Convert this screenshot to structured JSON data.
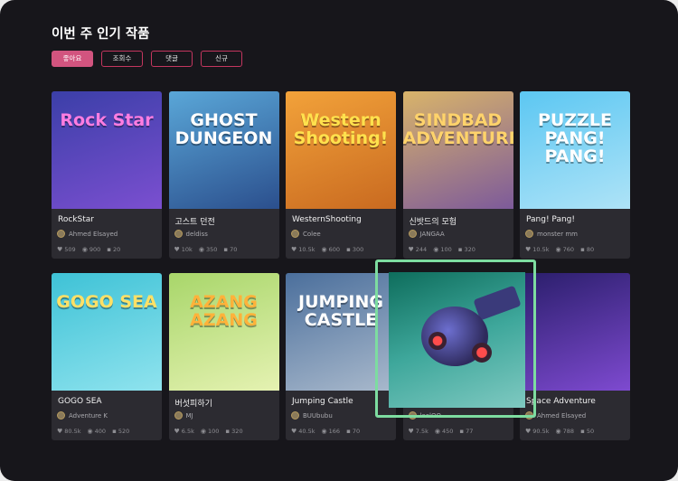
{
  "page": {
    "title": "이번 주 인기 작품"
  },
  "filters": [
    {
      "label": "좋아요",
      "active": true
    },
    {
      "label": "조회수",
      "active": false
    },
    {
      "label": "댓글",
      "active": false
    },
    {
      "label": "신규",
      "active": false
    }
  ],
  "cards": [
    {
      "title": "RockStar",
      "author": "Ahmed Elsayed",
      "likes": "509",
      "views": "900",
      "comments": "20",
      "art": "Rock Star",
      "bg": [
        "#3b3fa8",
        "#7b4fd0"
      ],
      "artColor": "#ff7de1"
    },
    {
      "title": "고스트 던전",
      "author": "deldiss",
      "likes": "10k",
      "views": "350",
      "comments": "70",
      "art": "GHOST DUNGEON",
      "bg": [
        "#5aa7d8",
        "#2b4f8d"
      ],
      "artColor": "#ffffff"
    },
    {
      "title": "WesternShooting",
      "author": "Colee",
      "likes": "10.5k",
      "views": "600",
      "comments": "300",
      "art": "Western Shooting!",
      "bg": [
        "#f2a23a",
        "#c96a20"
      ],
      "artColor": "#ffe14d"
    },
    {
      "title": "신밧드의 모험",
      "author": "JANGAA",
      "likes": "244",
      "views": "100",
      "comments": "320",
      "art": "SINDBAD ADVENTURE",
      "bg": [
        "#d9b46a",
        "#7d5a9a"
      ],
      "artColor": "#ffd36b"
    },
    {
      "title": "Pang! Pang!",
      "author": "monster mm",
      "likes": "10.5k",
      "views": "760",
      "comments": "80",
      "art": "PUZZLE PANG! PANG!",
      "bg": [
        "#5cc7f2",
        "#aee3f7"
      ],
      "artColor": "#ffffff"
    },
    {
      "title": "GOGO SEA",
      "author": "Adventure K",
      "likes": "80.5k",
      "views": "400",
      "comments": "520",
      "art": "GOGO SEA",
      "bg": [
        "#3ec2d6",
        "#8fe3ee"
      ],
      "artColor": "#ffe066"
    },
    {
      "title": "버섯피하기",
      "author": "MJ",
      "likes": "6.5k",
      "views": "100",
      "comments": "320",
      "art": "AZANG AZANG",
      "bg": [
        "#a8d66a",
        "#e5f2b2"
      ],
      "artColor": "#ffb23a"
    },
    {
      "title": "Jumping Castle",
      "author": "BUUbubu",
      "likes": "40.5k",
      "views": "166",
      "comments": "70",
      "art": "JUMPING CASTLE",
      "bg": [
        "#4b6f9c",
        "#a9b9cc"
      ],
      "artColor": "#ffffff"
    },
    {
      "title": "",
      "author": "loolOO",
      "likes": "7.5k",
      "views": "450",
      "comments": "77",
      "art": "",
      "bg": [
        "#2a6c6a",
        "#6bb1a8"
      ],
      "artColor": "#ffffff"
    },
    {
      "title": "Space Adventure",
      "author": "Ahmed Elsayed",
      "likes": "90.5k",
      "views": "788",
      "comments": "50",
      "art": "",
      "bg": [
        "#2a1e6b",
        "#7e4ad0"
      ],
      "artColor": "#ffffff"
    }
  ],
  "icons": {
    "like": "heart-icon",
    "view": "eye-icon",
    "comment": "comment-icon"
  },
  "colors": {
    "accent": "#d2547f",
    "highlight": "#7ddca0",
    "background": "#17161b",
    "card": "#2c2b31"
  }
}
